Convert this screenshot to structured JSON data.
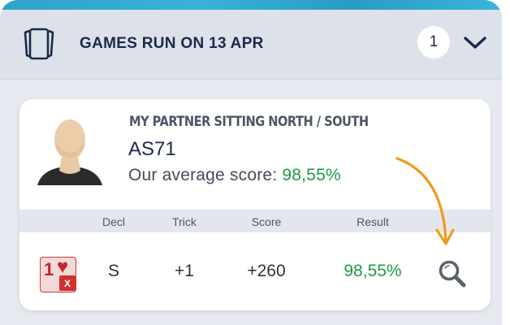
{
  "header": {
    "title": "GAMES RUN ON 13 APR",
    "count": "1",
    "cards_icon": "cards-icon",
    "expand_icon": "chevron-down-icon"
  },
  "partner_card": {
    "label": "MY PARTNER SITTING NORTH / SOUTH",
    "pair_name": "AS71",
    "average_label": "Our average score: ",
    "average_value": "98,55%",
    "avatar_icon": "person-silhouette"
  },
  "table": {
    "columns": [
      "Decl",
      "Trick",
      "Score",
      "Result"
    ],
    "rows": [
      {
        "contract_level": "1",
        "contract_suit": "♥",
        "contract_double": "X",
        "decl": "S",
        "trick": "+1",
        "score": "+260",
        "result": "98,55%",
        "action_icon": "magnifier-icon"
      }
    ]
  },
  "colors": {
    "accent_green": "#1e9a43",
    "heading_navy": "#1a2a4a",
    "hint_arrow": "#f29a1a",
    "suit_red": "#c1272d"
  }
}
